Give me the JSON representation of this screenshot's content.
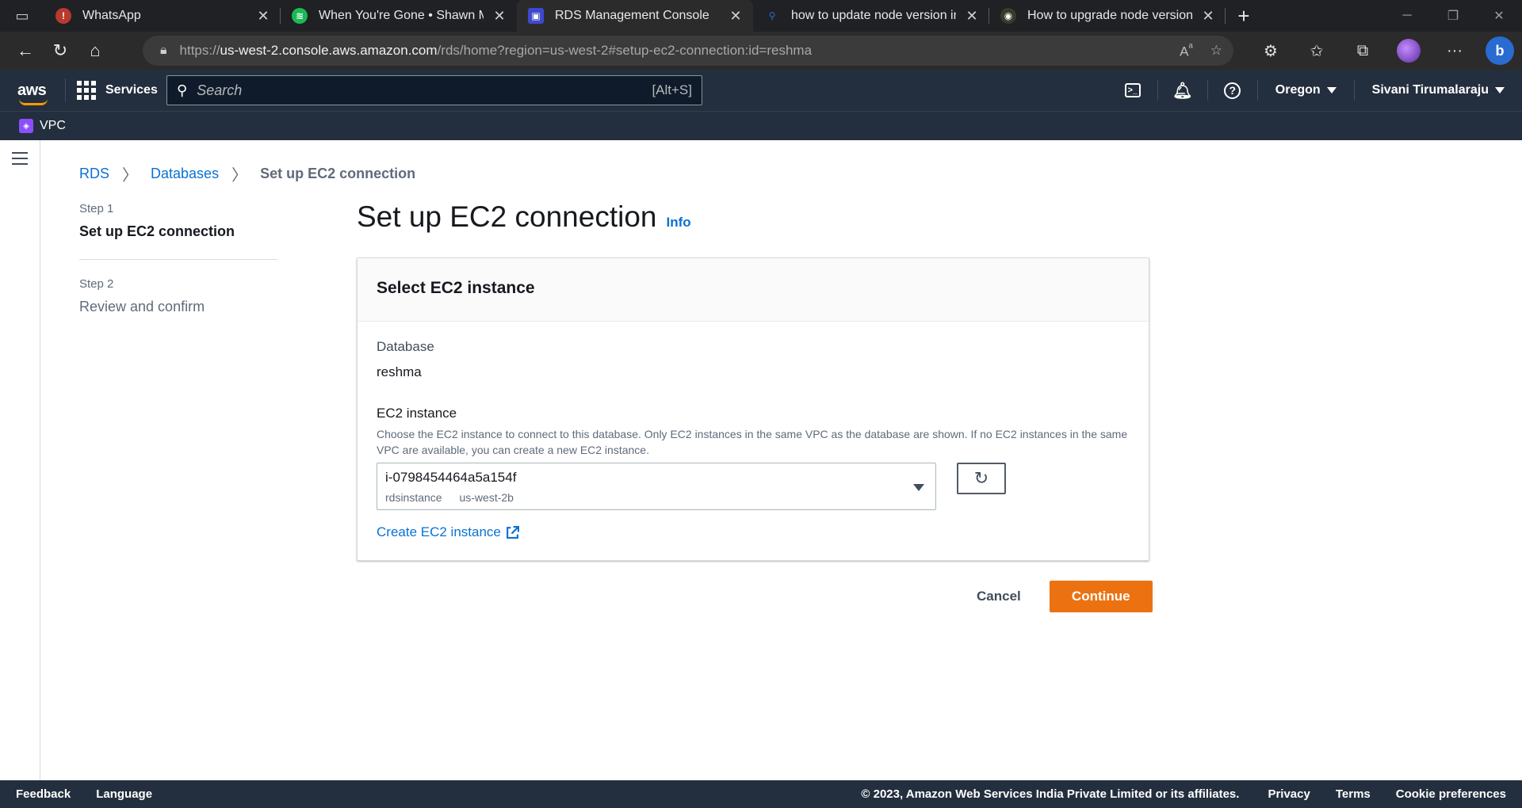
{
  "browser": {
    "tabs": [
      {
        "title": "WhatsApp",
        "favicon": "whatsapp-icon",
        "color": "#b83a2e"
      },
      {
        "title": "When You're Gone • Shawn Mendes",
        "favicon": "spotify-icon",
        "color": "#1db954"
      },
      {
        "title": "RDS Management Console",
        "favicon": "rds-icon",
        "color": "#3f48cc",
        "active": true
      },
      {
        "title": "how to update node version in ubuntu",
        "favicon": "search-icon",
        "color": "#2a6bd1"
      },
      {
        "title": "How to upgrade node version ubuntu",
        "favicon": "site-icon",
        "color": "#3a3a2a"
      }
    ],
    "url_prefix": "https://",
    "url_domain": "us-west-2.console.aws.amazon.com",
    "url_path": "/rds/home?region=us-west-2#setup-ec2-connection:id=reshma"
  },
  "aws": {
    "services_label": "Services",
    "search_placeholder": "Search",
    "search_shortcut": "[Alt+S]",
    "region": "Oregon",
    "user": "Sivani Tirumalaraju",
    "favorite": "VPC"
  },
  "breadcrumb": {
    "items": [
      "RDS",
      "Databases"
    ],
    "current": "Set up EC2 connection"
  },
  "steps": [
    {
      "num": "Step 1",
      "title": "Set up EC2 connection"
    },
    {
      "num": "Step 2",
      "title": "Review and confirm"
    }
  ],
  "page": {
    "title": "Set up EC2 connection",
    "info": "Info"
  },
  "panel": {
    "header": "Select EC2 instance",
    "database_label": "Database",
    "database_value": "reshma",
    "ec2_label": "EC2 instance",
    "ec2_desc": "Choose the EC2 instance to connect to this database. Only EC2 instances in the same VPC as the database are shown. If no EC2 instances in the same VPC are available, you can create a new EC2 instance.",
    "selected_instance": "i-0798454464a5a154f",
    "instance_name": "rdsinstance",
    "instance_az": "us-west-2b",
    "create_link": "Create EC2 instance"
  },
  "actions": {
    "cancel": "Cancel",
    "continue": "Continue"
  },
  "footer": {
    "feedback": "Feedback",
    "language": "Language",
    "copyright": "© 2023, Amazon Web Services India Private Limited or its affiliates.",
    "privacy": "Privacy",
    "terms": "Terms",
    "cookies": "Cookie preferences"
  }
}
